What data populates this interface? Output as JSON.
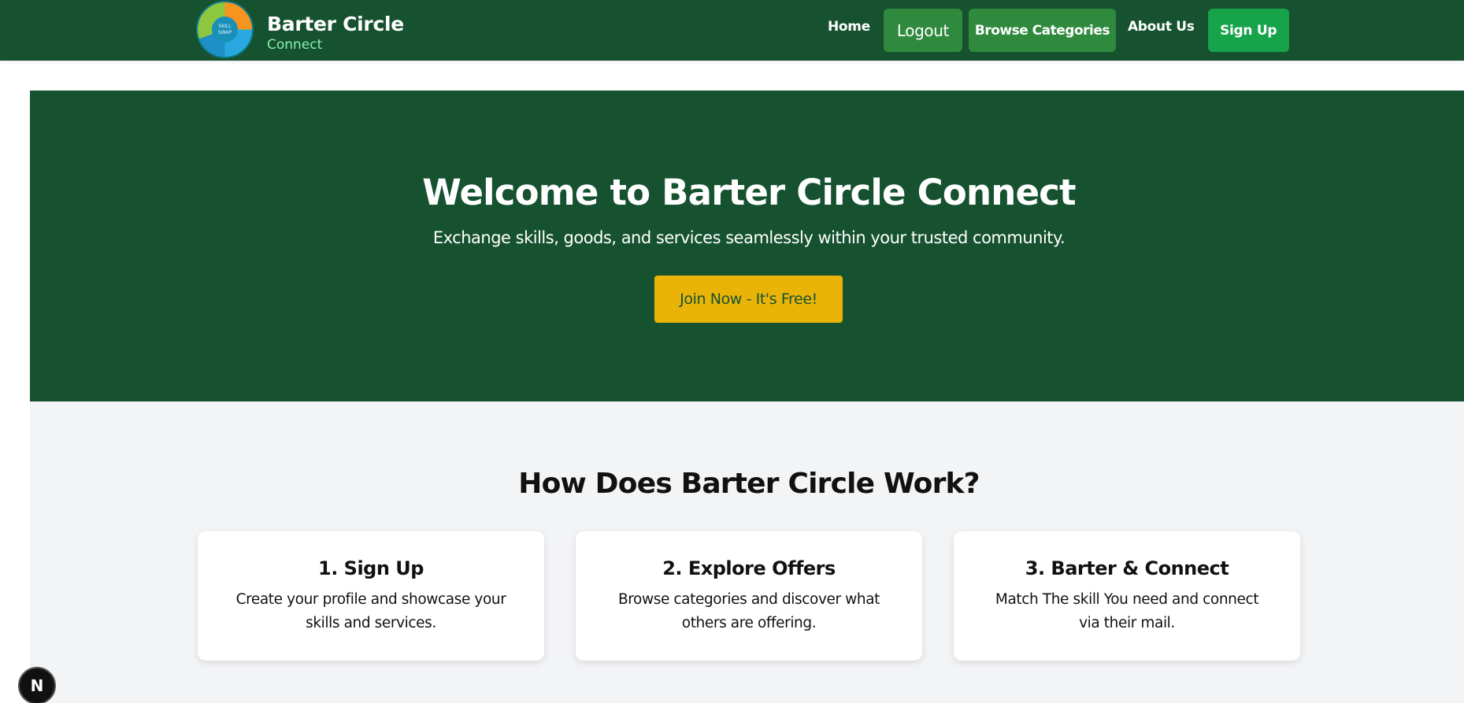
{
  "brand": {
    "title": "Barter Circle",
    "subtitle": "Connect",
    "logo_text": "SKILL SWAP"
  },
  "nav": {
    "home": "Home",
    "logout": "Logout",
    "browse": "Browse Categories",
    "about": "About Us",
    "signup": "Sign Up"
  },
  "hero": {
    "title": "Welcome to Barter Circle Connect",
    "subtitle": "Exchange skills, goods, and services seamlessly within your trusted community.",
    "cta": "Join Now - It's Free!"
  },
  "how": {
    "title": "How Does Barter Circle Work?",
    "steps": [
      {
        "title": "1. Sign Up",
        "text": "Create your profile and showcase your skills and services."
      },
      {
        "title": "2. Explore Offers",
        "text": "Browse categories and discover what others are offering."
      },
      {
        "title": "3. Barter & Connect",
        "text": "Match The skill You need and connect via their mail."
      }
    ]
  },
  "dev_badge": {
    "label": "N"
  },
  "colors": {
    "primary_green": "#165230",
    "button_green": "#2f8a3e",
    "signup_green": "#17a34a",
    "accent_yellow": "#eab308",
    "section_bg": "#f3f4f6"
  }
}
